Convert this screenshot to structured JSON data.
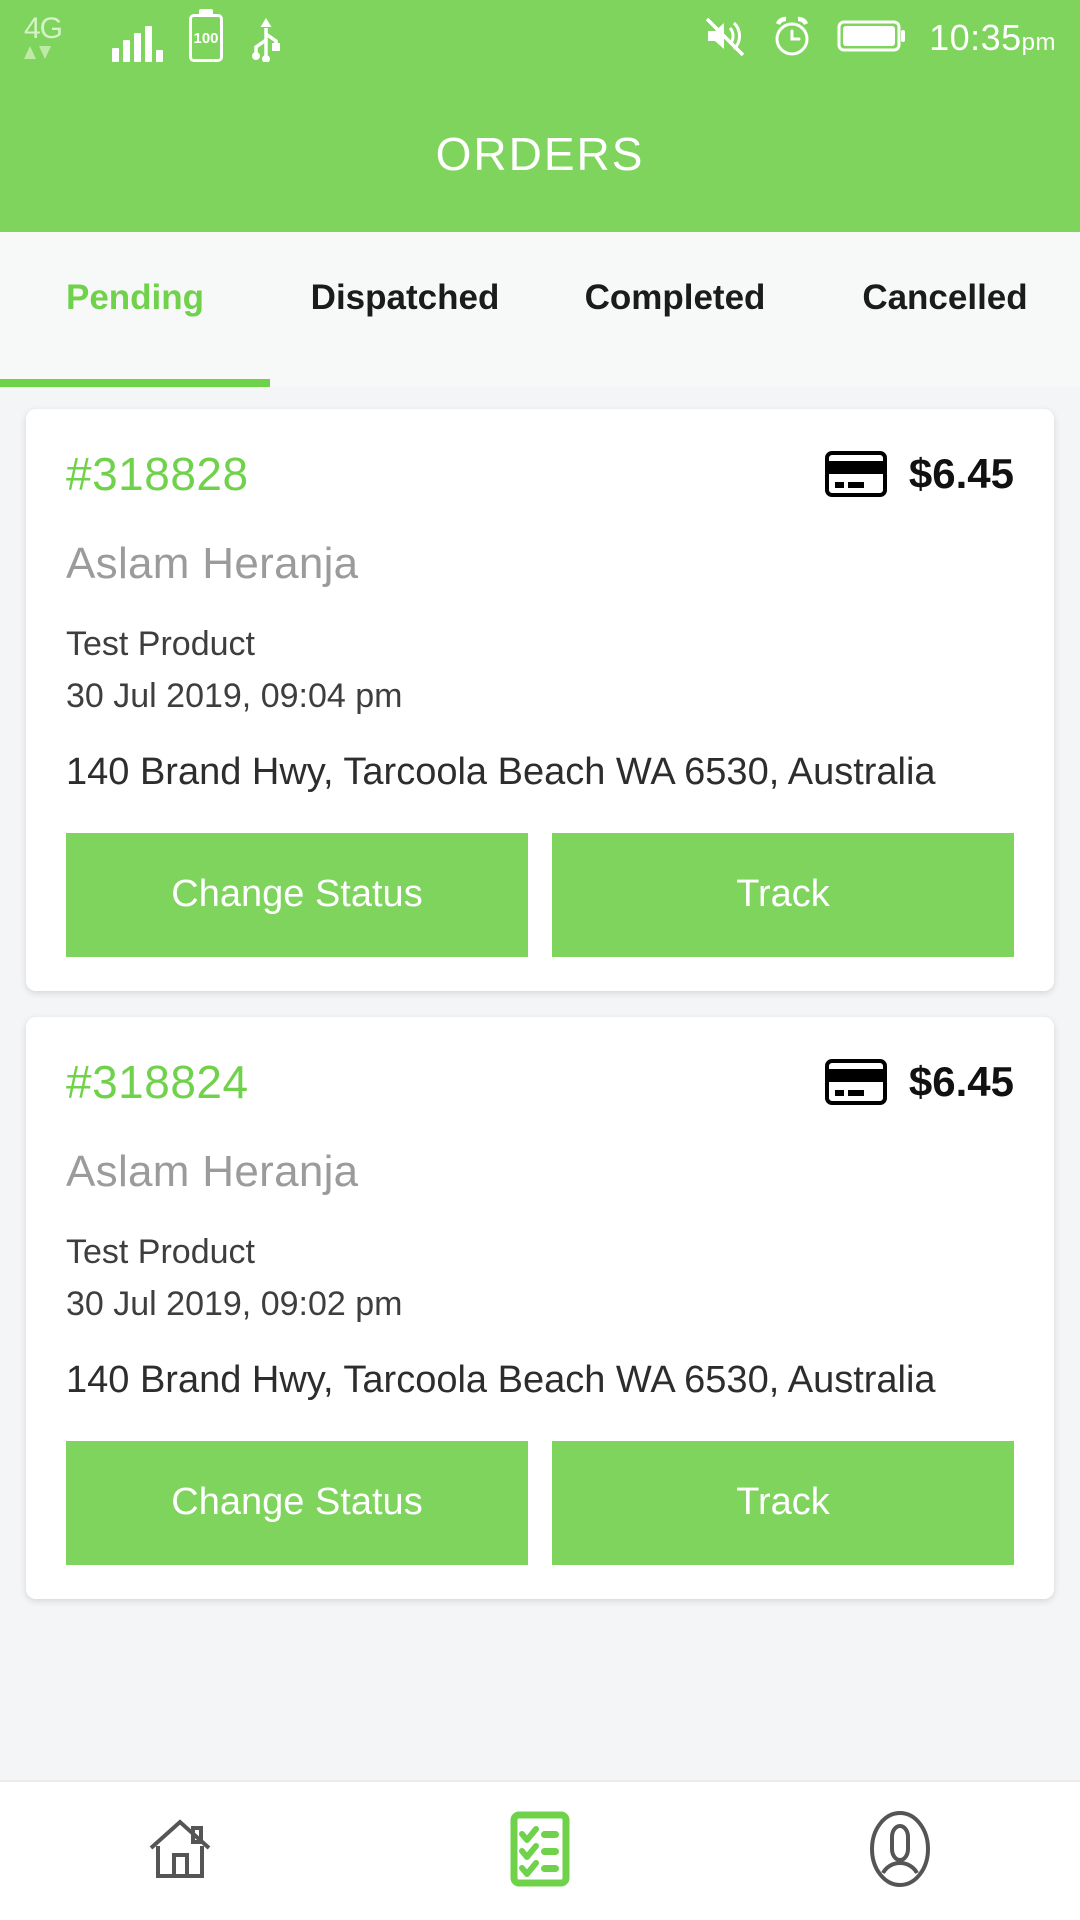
{
  "theme": {
    "green": "#7ed45c",
    "green_text": "#6fd24a",
    "bg": "#f4f5f6",
    "card_bg": "#ffffff",
    "muted": "#9b9b9b"
  },
  "statusbar": {
    "network_label": "4G",
    "battery_level": "100",
    "time": "10:35",
    "meridiem": "pm",
    "icons": [
      "4g-network-icon",
      "signal-bars-icon",
      "battery-icon",
      "usb-icon",
      "mute-icon",
      "alarm-icon",
      "battery-full-icon"
    ]
  },
  "header": {
    "title": "ORDERS"
  },
  "tabs": [
    {
      "label": "Pending",
      "active": true
    },
    {
      "label": "Dispatched",
      "active": false
    },
    {
      "label": "Completed",
      "active": false
    },
    {
      "label": "Cancelled",
      "active": false
    }
  ],
  "orders": [
    {
      "id": "#318828",
      "amount": "$6.45",
      "payment_icon": "credit-card-icon",
      "customer": "Aslam Heranja",
      "product": "Test Product",
      "datetime": "30 Jul 2019, 09:04 pm",
      "address": "140 Brand Hwy, Tarcoola Beach WA 6530, Australia",
      "primary_action": "Change Status",
      "secondary_action": "Track"
    },
    {
      "id": "#318824",
      "amount": "$6.45",
      "payment_icon": "credit-card-icon",
      "customer": "Aslam Heranja",
      "product": "Test Product",
      "datetime": "30 Jul 2019, 09:02 pm",
      "address": "140 Brand Hwy, Tarcoola Beach WA 6530, Australia",
      "primary_action": "Change Status",
      "secondary_action": "Track"
    }
  ],
  "bottomnav": [
    {
      "name": "home",
      "icon": "home-icon",
      "active": false
    },
    {
      "name": "orders",
      "icon": "checklist-icon",
      "active": true
    },
    {
      "name": "profile",
      "icon": "person-icon",
      "active": false
    }
  ]
}
